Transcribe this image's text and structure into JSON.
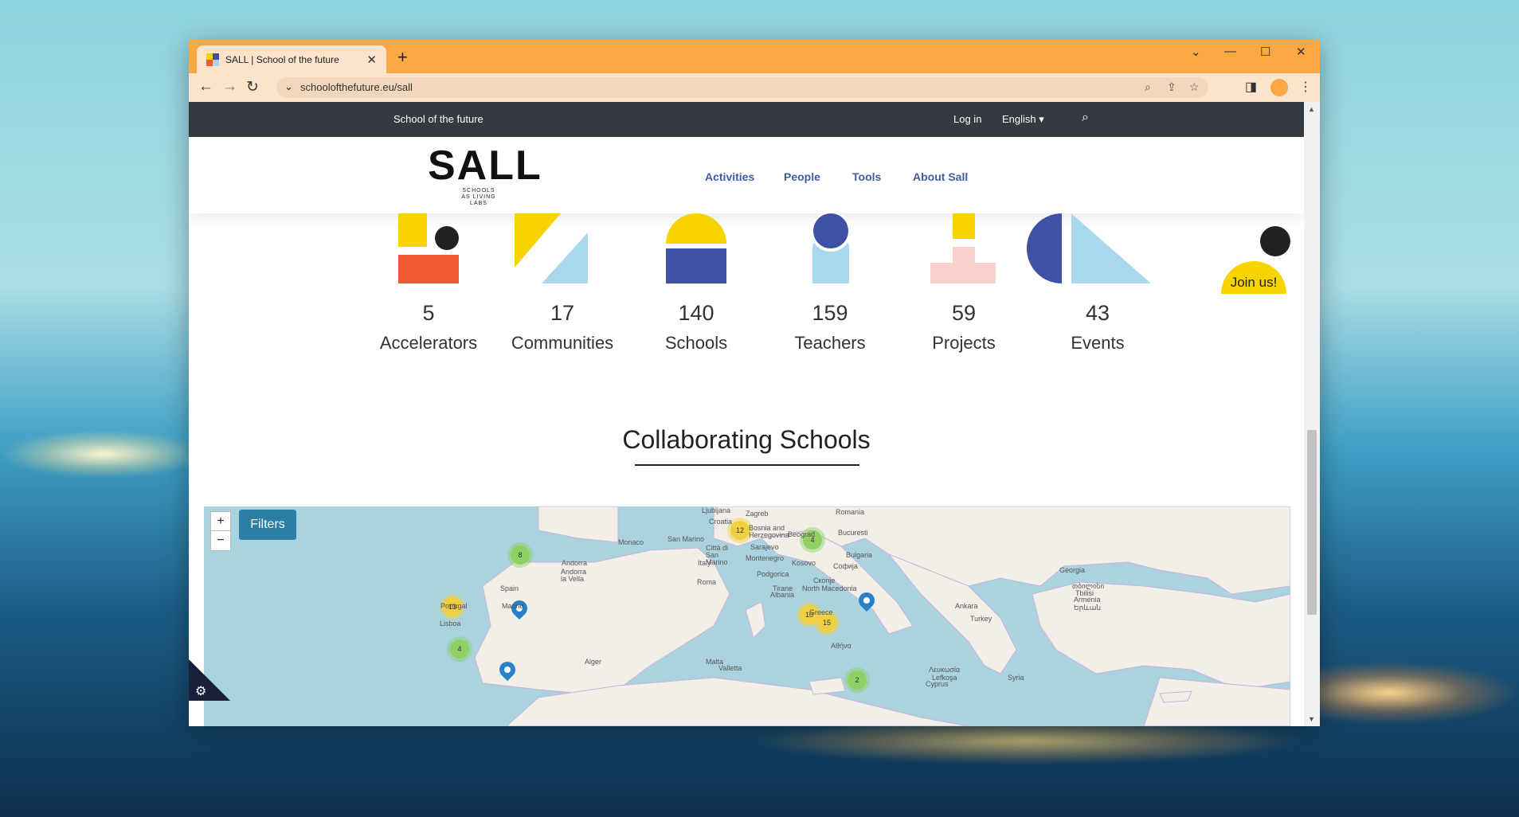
{
  "browser": {
    "tab_title": "SALL | School of the future",
    "url": "schoolofthefuture.eu/sall",
    "new_tab": "+",
    "close_tab": "✕"
  },
  "site": {
    "top_bar_title": "School of the future",
    "login": "Log in",
    "language": "English",
    "logo": "SALL",
    "logo_sub": "SCHOOLS AS LIVING LABS",
    "menu": [
      "Activities",
      "People",
      "Tools",
      "About Sall"
    ],
    "join": "Join us!"
  },
  "stats": [
    {
      "value": "5",
      "label": "Accelerators"
    },
    {
      "value": "17",
      "label": "Communities"
    },
    {
      "value": "140",
      "label": "Schools"
    },
    {
      "value": "159",
      "label": "Teachers"
    },
    {
      "value": "59",
      "label": "Projects"
    },
    {
      "value": "43",
      "label": "Events"
    }
  ],
  "section_title": "Collaborating Schools",
  "map": {
    "zoom_in": "+",
    "zoom_out": "−",
    "filters": "Filters",
    "clusters": [
      "8",
      "13",
      "4",
      "12",
      "4",
      "10",
      "15",
      "2"
    ],
    "labels": [
      "Ljubljana",
      "Zagreb",
      "Romania",
      "Croatia",
      "Bosnia and Herzegovina",
      "Monaco",
      "San Marino",
      "Bucuresti",
      "Andorra",
      "Andorra la Vella",
      "Città di San Marino",
      "Sarajevo",
      "Beograd",
      "Bulgaria",
      "Italy",
      "Montenegro",
      "Kosovo",
      "Софија",
      "Georgia",
      "Spain",
      "Roma",
      "Podgorica",
      "Скопје",
      "North Macedonia",
      "Tirane",
      "Albania",
      "Portugal",
      "Madrid",
      "Lisboa",
      "Ankara",
      "Turkey",
      "Alger",
      "Malta",
      "Valletta",
      "Greece",
      "Αθήνα",
      "Λευκωσία",
      "Lefkoşa",
      "Cyprus",
      "Syria",
      "თბილისი",
      "Tbilisi",
      "Armenia",
      "Երևան"
    ]
  },
  "colors": {
    "accent": "#f9a843",
    "nav": "#343a40",
    "link": "#3f5ba7",
    "yellow": "#f7d300",
    "blue": "#3f51a5",
    "lightblue": "#a9d8ee",
    "orange": "#f05a32",
    "pink": "#f9cfc9"
  }
}
